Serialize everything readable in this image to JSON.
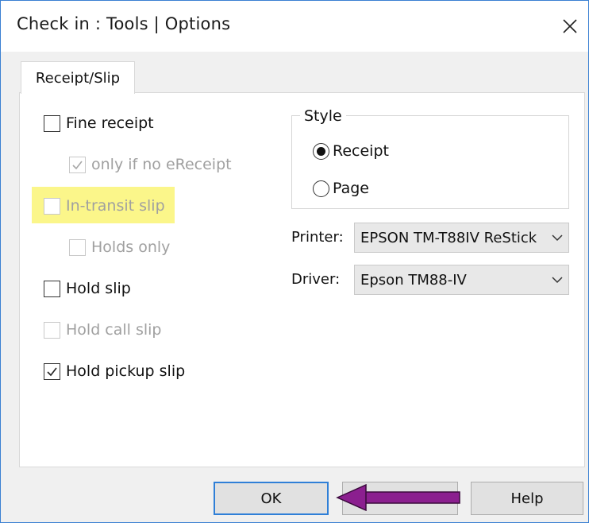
{
  "window": {
    "title": "Check in : Tools | Options",
    "close_icon": "close-icon"
  },
  "tabs": [
    {
      "label": "Receipt/Slip",
      "selected": true
    }
  ],
  "options": {
    "fine_receipt": {
      "label": "Fine receipt",
      "checked": false,
      "enabled": true
    },
    "only_if_no_ereceipt": {
      "label": "only if no eReceipt",
      "checked": true,
      "enabled": false
    },
    "in_transit_slip": {
      "label": "In-transit slip",
      "checked": false,
      "enabled": false,
      "highlighted": true
    },
    "holds_only": {
      "label": "Holds only",
      "checked": false,
      "enabled": false
    },
    "hold_slip": {
      "label": "Hold slip",
      "checked": false,
      "enabled": true
    },
    "hold_call_slip": {
      "label": "Hold call slip",
      "checked": false,
      "enabled": false
    },
    "hold_pickup_slip": {
      "label": "Hold pickup slip",
      "checked": true,
      "enabled": true
    }
  },
  "style": {
    "label": "Style",
    "receipt_label": "Receipt",
    "page_label": "Page",
    "selected": "Receipt"
  },
  "printer": {
    "label": "Printer:",
    "value": "EPSON TM-T88IV ReStick"
  },
  "driver": {
    "label": "Driver:",
    "value": "Epson TM88-IV"
  },
  "buttons": {
    "ok": "OK",
    "cancel": "Cancel",
    "help": "Help"
  },
  "colors": {
    "highlight": "#fbf68a",
    "arrow": "#8b1f8f",
    "default_button_border": "#2f7fd7"
  }
}
